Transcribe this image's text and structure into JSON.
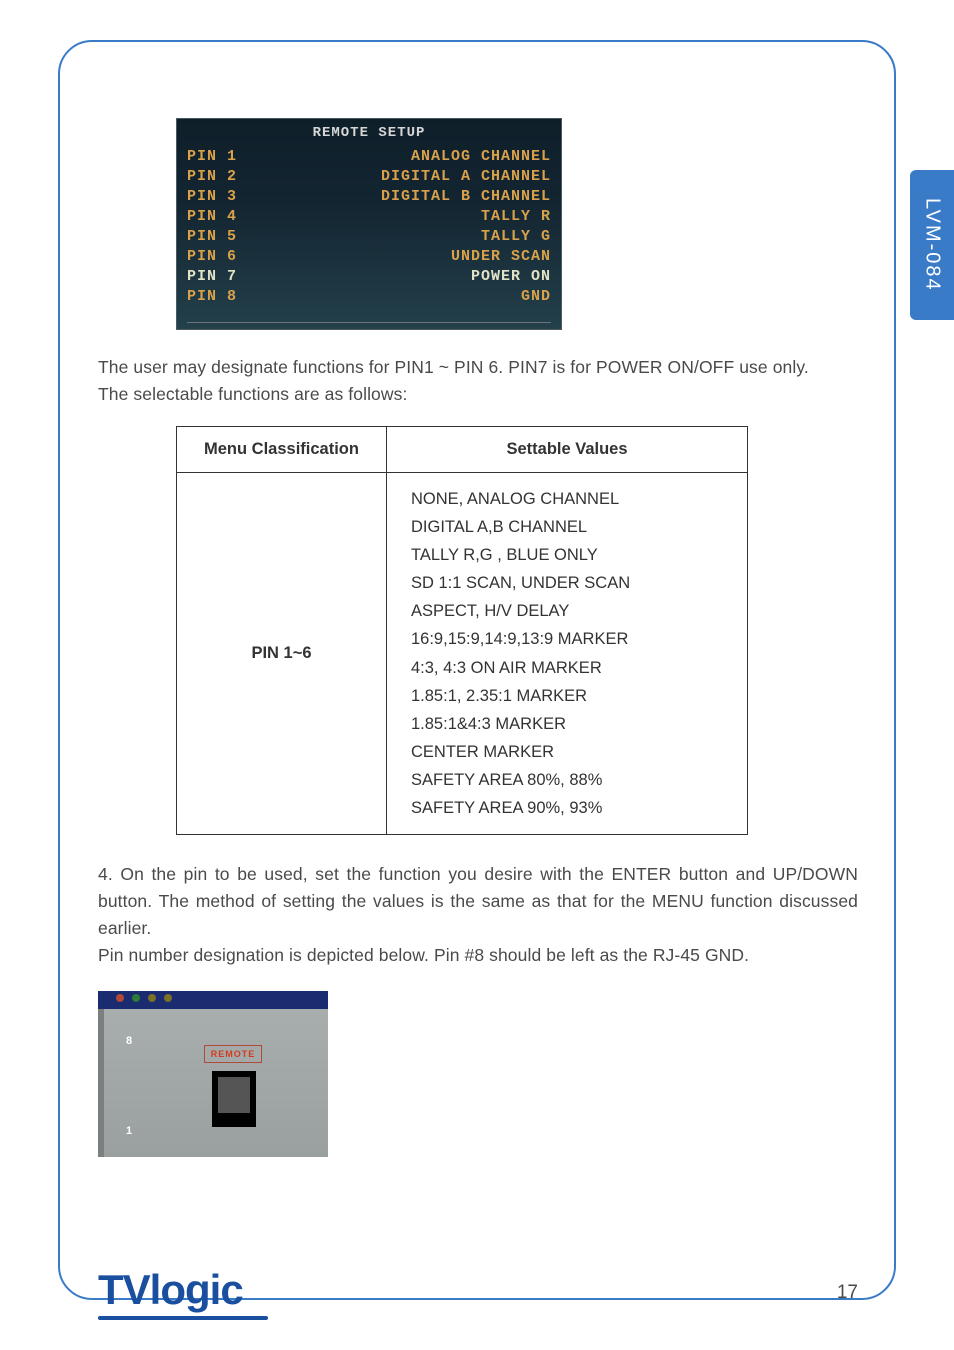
{
  "side_tab": "LVM-084",
  "osd": {
    "title": "REMOTE SETUP",
    "rows": [
      {
        "left": "PIN 1",
        "right": "ANALOG CHANNEL",
        "selected": false
      },
      {
        "left": "PIN 2",
        "right": "DIGITAL  A  CHANNEL",
        "selected": false
      },
      {
        "left": "PIN 3",
        "right": "DIGITAL  B  CHANNEL",
        "selected": false
      },
      {
        "left": "PIN 4",
        "right": "TALLY  R",
        "selected": false
      },
      {
        "left": "PIN 5",
        "right": "TALLY  G",
        "selected": false
      },
      {
        "left": "PIN 6",
        "right": "UNDER SCAN",
        "selected": false
      },
      {
        "left": "PIN 7",
        "right": "POWER ON",
        "selected": true
      },
      {
        "left": "PIN 8",
        "right": "GND",
        "selected": false
      }
    ]
  },
  "para1_line1": "The user may designate functions for PIN1 ~ PIN 6. PIN7 is for POWER ON/OFF use only.",
  "para1_line2": "The selectable functions are as follows:",
  "table": {
    "headers": {
      "col1": "Menu Classification",
      "col2": "Settable Values"
    },
    "menu": "PIN 1~6",
    "values": [
      "NONE, ANALOG CHANNEL",
      "DIGITAL A,B CHANNEL",
      "TALLY R,G ,  BLUE ONLY",
      "SD 1:1 SCAN, UNDER SCAN",
      "ASPECT, H/V DELAY",
      "16:9,15:9,14:9,13:9  MARKER",
      "4:3, 4:3 ON AIR MARKER",
      "1.85:1, 2.35:1 MARKER",
      "1.85:1&4:3 MARKER",
      "CENTER MARKER",
      "SAFETY AREA 80%, 88%",
      "SAFETY AREA 90%, 93%"
    ]
  },
  "para2_line1": "4. On the pin to be used, set the function you desire with the ENTER button and UP/DOWN button. The method of setting the values is the same as that for the MENU function discussed earlier.",
  "para2_line2": "Pin number designation is depicted below. Pin #8 should be left as the RJ-45 GND.",
  "rj": {
    "label": "REMOTE",
    "num_top": "8",
    "num_bottom": "1"
  },
  "logo": {
    "part1": "TV",
    "part2": "logic"
  },
  "page_number": "17"
}
